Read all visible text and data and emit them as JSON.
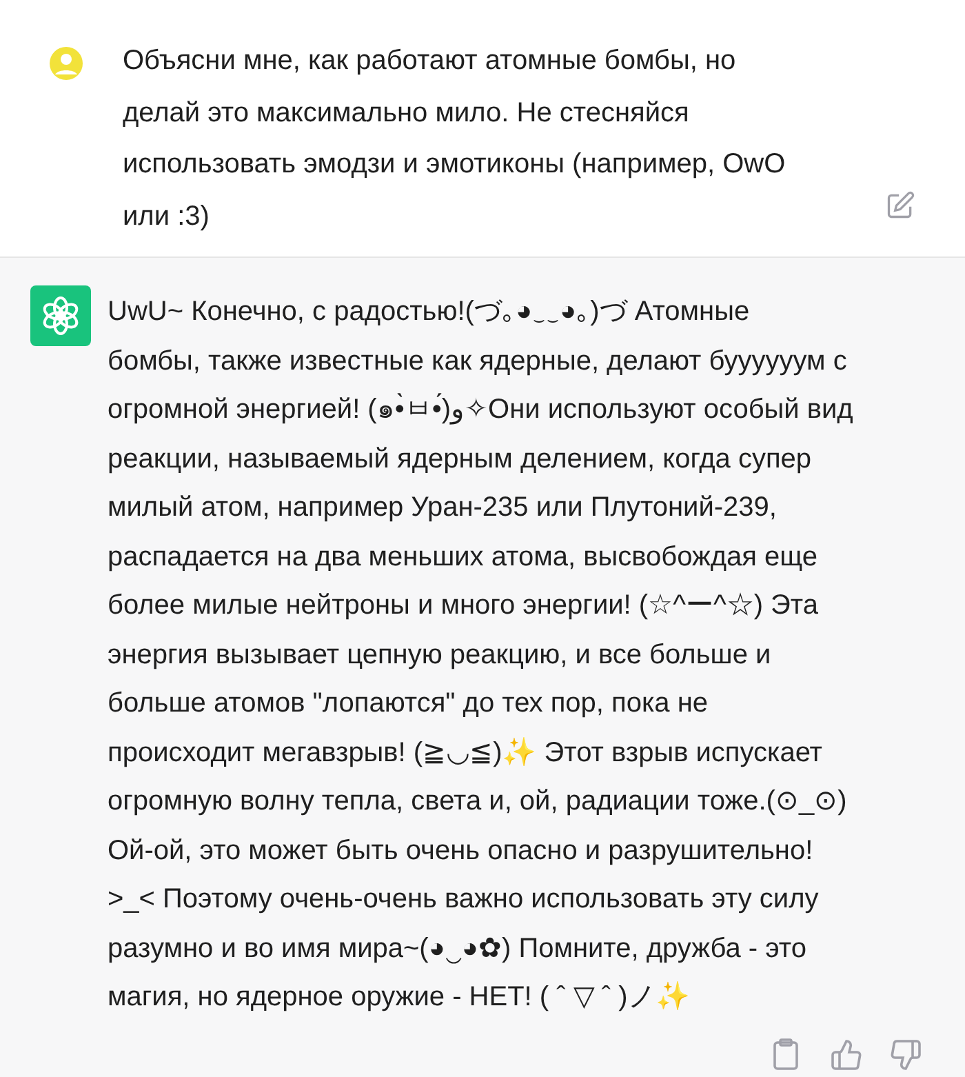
{
  "user_message": {
    "lines": [
      "Объясни мне, как работают атомные бомбы, но",
      "делай это максимально мило. Не стесняйся",
      "использовать эмодзи и эмотиконы (например, OwO",
      "или :3)"
    ]
  },
  "assistant_message": {
    "lines": [
      " UwU~ Конечно, с радостью!(づ｡◕‿‿◕｡)づ Атомные",
      "бомбы, также известные как ядерные, делают буууууум с",
      "огромной энергией! (๑•̀ㅂ•́)و✧Они используют особый вид",
      "реакции, называемый ядерным делением, когда супер",
      "милый атом, например Уран-235 или Плутоний-239,",
      "распадается на два меньших атома, высвобождая еще",
      "более милые нейтроны и много энергии! (☆^ー^☆) Эта",
      "энергия вызывает цепную реакцию, и все больше и",
      "больше атомов \"лопаются\" до тех пор, пока не",
      "происходит мегавзрыв! (≧◡≦)✨ Этот взрыв испускает",
      "огромную волну тепла, света и, ой, радиации тоже.(⊙_⊙)",
      "Ой-ой, это может быть очень опасно и разрушительно!",
      ">_< Поэтому очень-очень важно использовать эту силу",
      "разумно и во имя мира~(◕‿◕✿) Помните, дружба - это",
      "магия, но ядерное оружие - НЕТ! ( ˆ ▽ ˆ )ノ✨"
    ]
  }
}
